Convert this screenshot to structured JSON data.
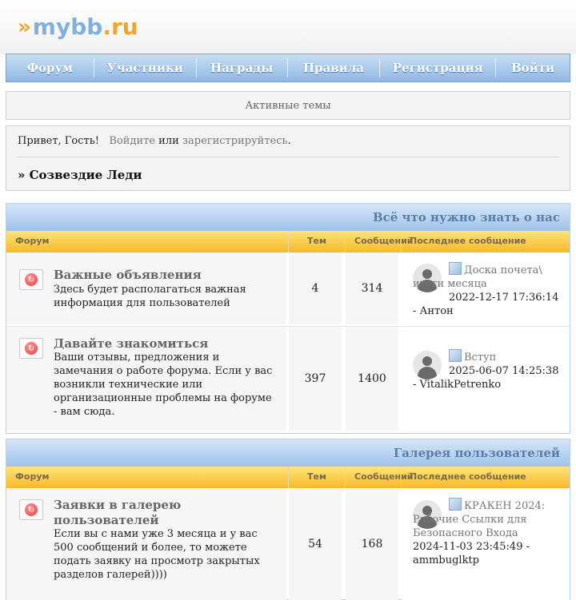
{
  "header": {
    "logo_arrows": "»",
    "logo_text": "mybb",
    "logo_dot": ".",
    "logo_tld": "ru"
  },
  "nav": {
    "items": [
      "Форум",
      "Участники",
      "Награды",
      "Правила",
      "Регистрация",
      "Войти"
    ]
  },
  "active_topics": "Активные темы",
  "welcome": {
    "hello": "Привет, Гость!",
    "login": "Войдите",
    "or": "или",
    "register": "зарегистрируйтесь",
    "period": ".",
    "board_name": "» Созвездие Леди"
  },
  "columns": {
    "forum": "Форум",
    "topics": "Тем",
    "posts": "Сообщений",
    "last_post": "Последнее сообщение"
  },
  "categories": [
    {
      "title": "Всё что нужно знать о нас",
      "forums": [
        {
          "title": "Важные объявления",
          "description": "Здесь будет располагаться важная информация для пользователей",
          "topics": "4",
          "posts": "314",
          "last_topic": "Доска почета\\ итоги месяца",
          "last_date": "2022-12-17 17:36:14",
          "last_author": "Антон"
        },
        {
          "title": "Давайте знакомиться",
          "description": "Ваши отзывы, предложения и замечания о работе форума. Если у вас возникли технические или организационные проблемы на форуме - вам сюда.",
          "topics": "397",
          "posts": "1400",
          "last_topic": "Вступ",
          "last_date": "2025-06-07 14:25:38",
          "last_author": "VitalikPetrenko"
        }
      ]
    },
    {
      "title": "Галерея пользователей",
      "forums": [
        {
          "title": "Заявки в галерею пользователей",
          "description": "Если вы с нами уже 3 месяца и у вас 500 сообщений и более, то можете подать заявку на просмотр закрытых разделов галерей))))",
          "topics": "54",
          "posts": "168",
          "last_topic": "КРАКЕН 2024: Рабочие Ссылки для Безопасного Входа",
          "last_date": "2024-11-03 23:45:49",
          "last_author": "ammbuglktp"
        }
      ]
    }
  ]
}
